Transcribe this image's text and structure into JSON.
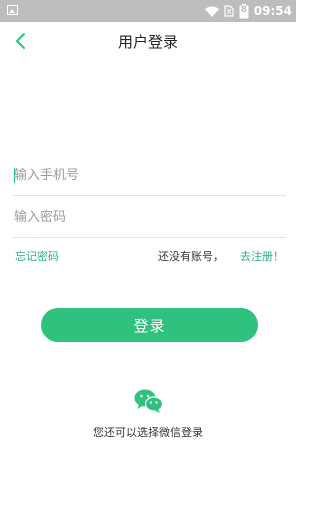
{
  "status_bar": {
    "time": "09:54",
    "battery_level": "8"
  },
  "header": {
    "title": "用户登录"
  },
  "form": {
    "phone_placeholder": "输入手机号",
    "password_placeholder": "输入密码"
  },
  "links": {
    "forgot_password": "忘记密码",
    "no_account": "还没有账号，",
    "register": "去注册！"
  },
  "login_button": "登录",
  "wechat": {
    "prompt": "您还可以选择微信登录"
  },
  "colors": {
    "accent": "#2ec27e",
    "status_bar": "#bdbdbd"
  }
}
